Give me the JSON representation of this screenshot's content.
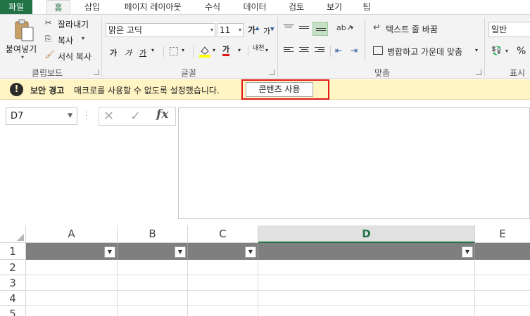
{
  "ribbon_tabs": [
    "파일",
    "홈",
    "삽입",
    "페이지 레이아웃",
    "수식",
    "데이터",
    "검토",
    "보기",
    "팁"
  ],
  "clipboard": {
    "paste": "붙여넣기",
    "cut": "잘라내기",
    "copy": "복사",
    "format_painter": "서식 복사",
    "group_label": "클립보드"
  },
  "font": {
    "name": "맑은 고딕",
    "size": "11",
    "grow": "가",
    "shrink": "가",
    "bold": "가",
    "italic": "가",
    "underline": "가",
    "font_color": "가",
    "phonetic": "내천",
    "group_label": "글꼴"
  },
  "alignment": {
    "wrap_text": "텍스트 줄 바꿈",
    "merge_center": "병합하고 가운데 맞춤",
    "group_label": "맞춤"
  },
  "number": {
    "format": "일반",
    "percent": "%",
    "group_label": "표시"
  },
  "security_bar": {
    "title": "보안 경고",
    "message": "매크로를 사용할 수 없도록 설정했습니다.",
    "button": "콘텐츠 사용"
  },
  "formula_bar": {
    "name_box": "D7",
    "fx": "fx",
    "cancel": "✕",
    "enter": "✓"
  },
  "sheet": {
    "columns": [
      "A",
      "B",
      "C",
      "D",
      "E"
    ],
    "selected_column": "D",
    "rows": [
      "1",
      "2",
      "3",
      "4",
      "5"
    ]
  },
  "colors": {
    "file_tab": "#217346",
    "accent": "#217346",
    "security_bar_bg": "#fff4c4",
    "header_row_fill": "#7f7f7f",
    "highlight_box": "#e01818"
  }
}
